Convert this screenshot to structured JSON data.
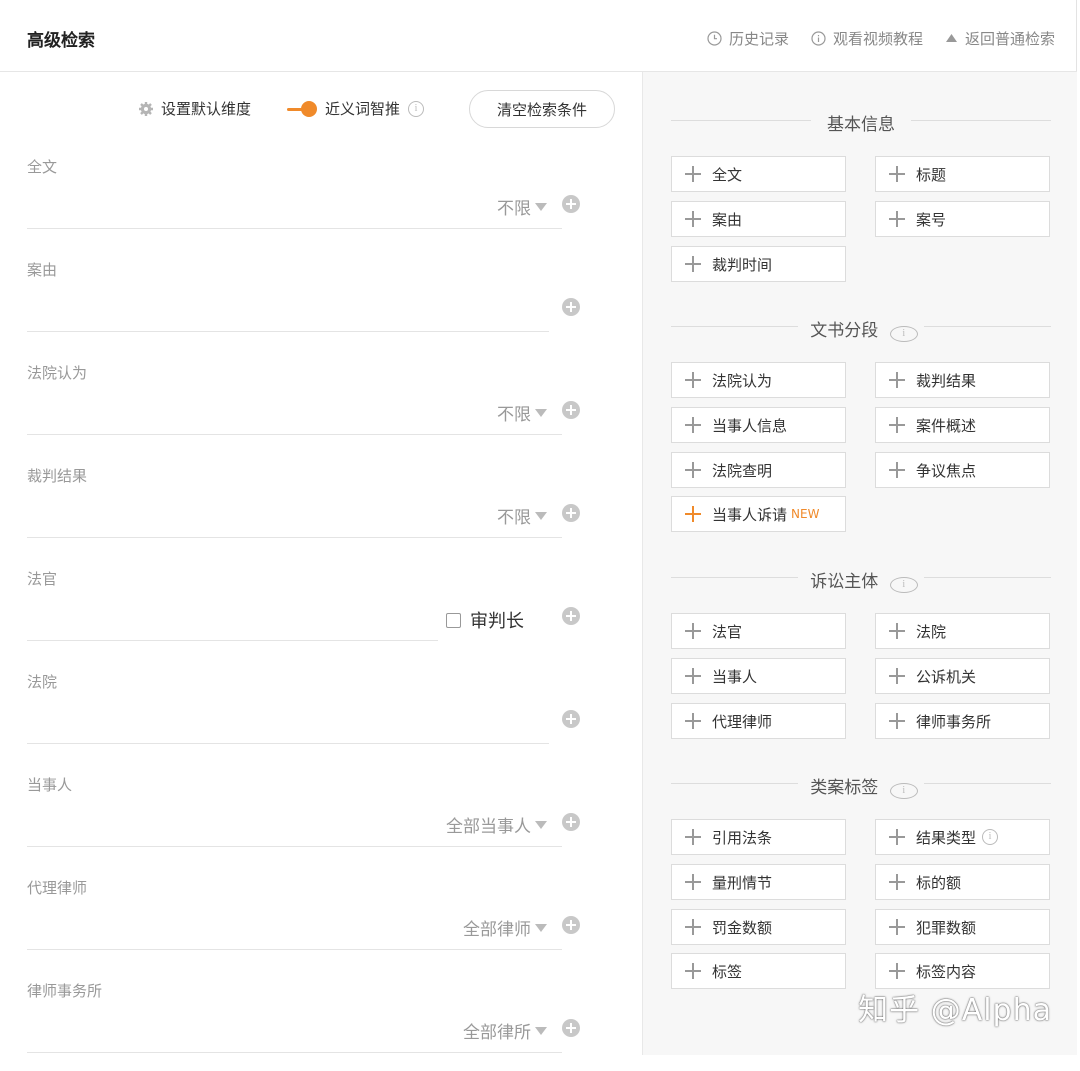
{
  "header": {
    "title": "高级检索",
    "links": [
      {
        "label": "历史记录",
        "icon": "clock-icon"
      },
      {
        "label": "观看视频教程",
        "icon": "info-icon"
      },
      {
        "label": "返回普通检索",
        "icon": "triangle-up-icon"
      }
    ]
  },
  "options": {
    "default_dimension": "设置默认维度",
    "synonym_label": "近义词智推",
    "synonym_enabled": true,
    "clear_button": "清空检索条件"
  },
  "fields": [
    {
      "label": "全文",
      "select": "不限"
    },
    {
      "label": "案由",
      "select": ""
    },
    {
      "label": "法院认为",
      "select": "不限"
    },
    {
      "label": "裁判结果",
      "select": "不限"
    },
    {
      "label": "法官",
      "checkbox": "审判长"
    },
    {
      "label": "法院",
      "select": ""
    },
    {
      "label": "当事人",
      "select": "全部当事人"
    },
    {
      "label": "代理律师",
      "select": "全部律师"
    },
    {
      "label": "律师事务所",
      "select": "全部律所"
    }
  ],
  "sections": [
    {
      "title": "基本信息",
      "items": [
        "全文",
        "标题",
        "案由",
        "案号",
        "裁判时间"
      ]
    },
    {
      "title": "文书分段",
      "items": [
        "法院认为",
        "裁判结果",
        "当事人信息",
        "案件概述",
        "法院查明",
        "争议焦点",
        "当事人诉请"
      ],
      "new_badge": "NEW"
    },
    {
      "title": "诉讼主体",
      "items": [
        "法官",
        "法院",
        "当事人",
        "公诉机关",
        "代理律师",
        "律师事务所"
      ]
    },
    {
      "title": "类案标签",
      "items": [
        "引用法条",
        "结果类型",
        "量刑情节",
        "标的额",
        "罚金数额",
        "犯罪数额",
        "标签",
        "标签内容"
      ]
    }
  ],
  "watermark": "知乎 @Alpha",
  "colors": {
    "accent": "#f08a2a",
    "panel_bg": "#f7f7f7"
  }
}
